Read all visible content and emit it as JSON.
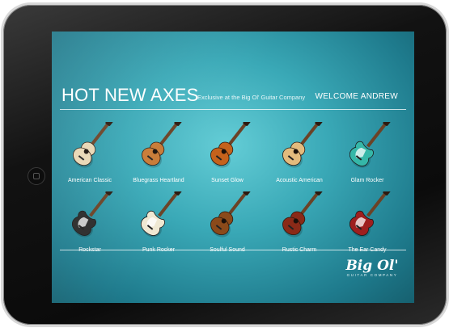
{
  "page": {
    "title": "HOT NEW AXES",
    "subtitle": "Exclusive at the Big Ol' Guitar Company",
    "welcome": "WELCOME ANDREW"
  },
  "guitars": [
    {
      "name": "American Classic",
      "icon": "archtop-guitar-icon",
      "color": "#e9d7b4"
    },
    {
      "name": "Bluegrass Heartland",
      "icon": "hollowbody-guitar-icon",
      "color": "#c87a35"
    },
    {
      "name": "Sunset Glow",
      "icon": "acoustic-guitar-icon",
      "color": "#c5621c"
    },
    {
      "name": "Acoustic American",
      "icon": "acoustic-guitar-icon",
      "color": "#e3bb7d"
    },
    {
      "name": "Glam Rocker",
      "icon": "electric-guitar-icon",
      "color": "#35b7a8"
    },
    {
      "name": "Rockstar",
      "icon": "electric-guitar-icon",
      "color": "#2a2a2a"
    },
    {
      "name": "Punk Rocker",
      "icon": "electric-guitar-icon",
      "color": "#efe8d2"
    },
    {
      "name": "Soulful Sound",
      "icon": "les-paul-guitar-icon",
      "color": "#8b4a1a"
    },
    {
      "name": "Rustic Charm",
      "icon": "semi-hollow-guitar-icon",
      "color": "#8a2a18"
    },
    {
      "name": "The Ear Candy",
      "icon": "electric-guitar-icon",
      "color": "#9e1f1f"
    }
  ],
  "logo": {
    "brand": "Big Ol'",
    "tagline": "GUITAR COMPANY"
  }
}
